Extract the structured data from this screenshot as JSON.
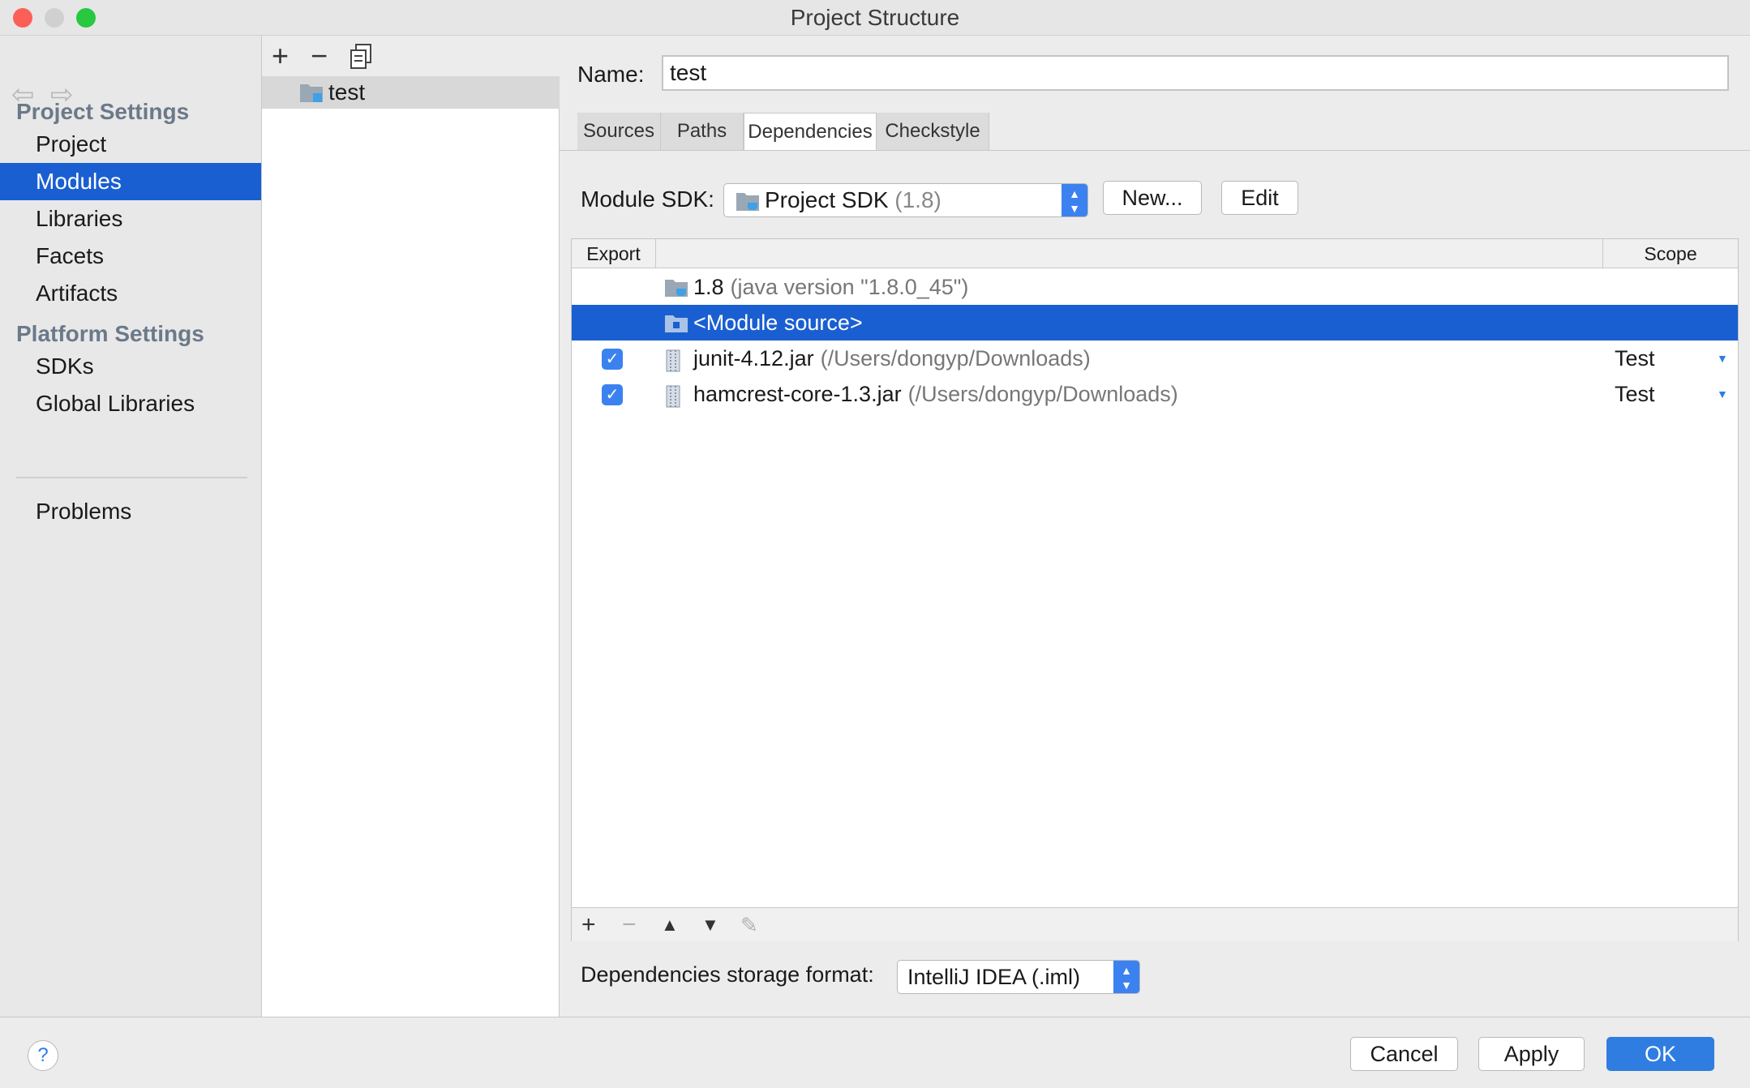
{
  "window": {
    "title": "Project Structure"
  },
  "sidebar": {
    "project_settings_heading": "Project Settings",
    "project_items": [
      "Project",
      "Modules",
      "Libraries",
      "Facets",
      "Artifacts"
    ],
    "platform_settings_heading": "Platform Settings",
    "platform_items": [
      "SDKs",
      "Global Libraries"
    ],
    "problems": "Problems",
    "selected": "Modules"
  },
  "modules": {
    "items": [
      "test"
    ],
    "selected": "test"
  },
  "main": {
    "name_label": "Name:",
    "name_value": "test",
    "tabs": [
      "Sources",
      "Paths",
      "Dependencies",
      "Checkstyle"
    ],
    "active_tab": "Dependencies",
    "module_sdk_label": "Module SDK:",
    "module_sdk_value": "Project SDK",
    "module_sdk_version": "(1.8)",
    "new_button": "New...",
    "edit_button": "Edit",
    "table": {
      "columns": [
        "Export",
        "",
        "Scope"
      ],
      "rows": [
        {
          "name": "1.8",
          "detail": "(java version \"1.8.0_45\")",
          "export": null,
          "scope": "",
          "icon": "sdk-folder-icon",
          "selected": false
        },
        {
          "name": "<Module source>",
          "detail": "",
          "export": null,
          "scope": "",
          "icon": "module-source-folder-icon",
          "selected": true
        },
        {
          "name": "junit-4.12.jar",
          "detail": "(/Users/dongyp/Downloads)",
          "export": true,
          "scope": "Test",
          "icon": "jar-icon",
          "selected": false
        },
        {
          "name": "hamcrest-core-1.3.jar",
          "detail": "(/Users/dongyp/Downloads)",
          "export": true,
          "scope": "Test",
          "icon": "jar-icon",
          "selected": false
        }
      ]
    },
    "storage_format_label": "Dependencies storage format:",
    "storage_format_value": "IntelliJ IDEA (.iml)"
  },
  "footer": {
    "help": "?",
    "cancel": "Cancel",
    "apply": "Apply",
    "ok": "OK"
  },
  "colors": {
    "selection": "#1a5fd1",
    "accent": "#2f7de0",
    "close": "#fc5f57",
    "minimize": "#d0d0d0",
    "zoom": "#28c840"
  }
}
